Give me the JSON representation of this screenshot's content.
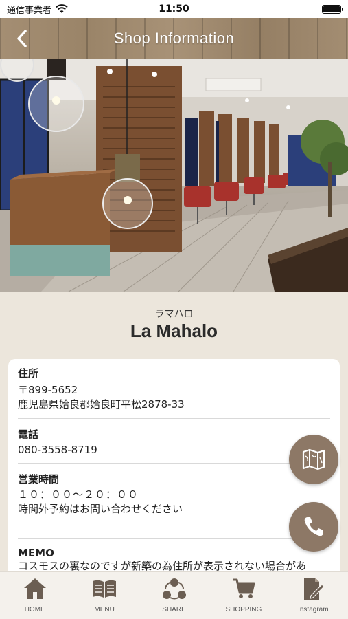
{
  "status_bar": {
    "carrier": "通信事業者",
    "time": "11:50"
  },
  "header": {
    "title": "Shop Information"
  },
  "shop": {
    "kana": "ラマハロ",
    "name": "La Mahalo"
  },
  "info": {
    "address_label": "住所",
    "postal_code": "〒899-5652",
    "address": "鹿児島県姶良郡姶良町平松2878-33",
    "phone_label": "電話",
    "phone": "080-3558-8719",
    "hours_label": "営業時間",
    "hours": "１０：００〜２０：００",
    "hours_note": "時間外予約はお問い合わせください",
    "memo_label": "MEMO",
    "memo": "コスモスの裏なのですが新築の為住所が表示されない場合があ"
  },
  "tabs": [
    {
      "label": "HOME",
      "icon": "home-icon"
    },
    {
      "label": "MENU",
      "icon": "book-icon"
    },
    {
      "label": "SHARE",
      "icon": "share-icon"
    },
    {
      "label": "SHOPPING",
      "icon": "cart-icon"
    },
    {
      "label": "Instagram",
      "icon": "document-pen-icon"
    }
  ],
  "colors": {
    "accent": "#8d7866",
    "background": "#ece6dc",
    "tab_icon": "#6b5e52"
  }
}
